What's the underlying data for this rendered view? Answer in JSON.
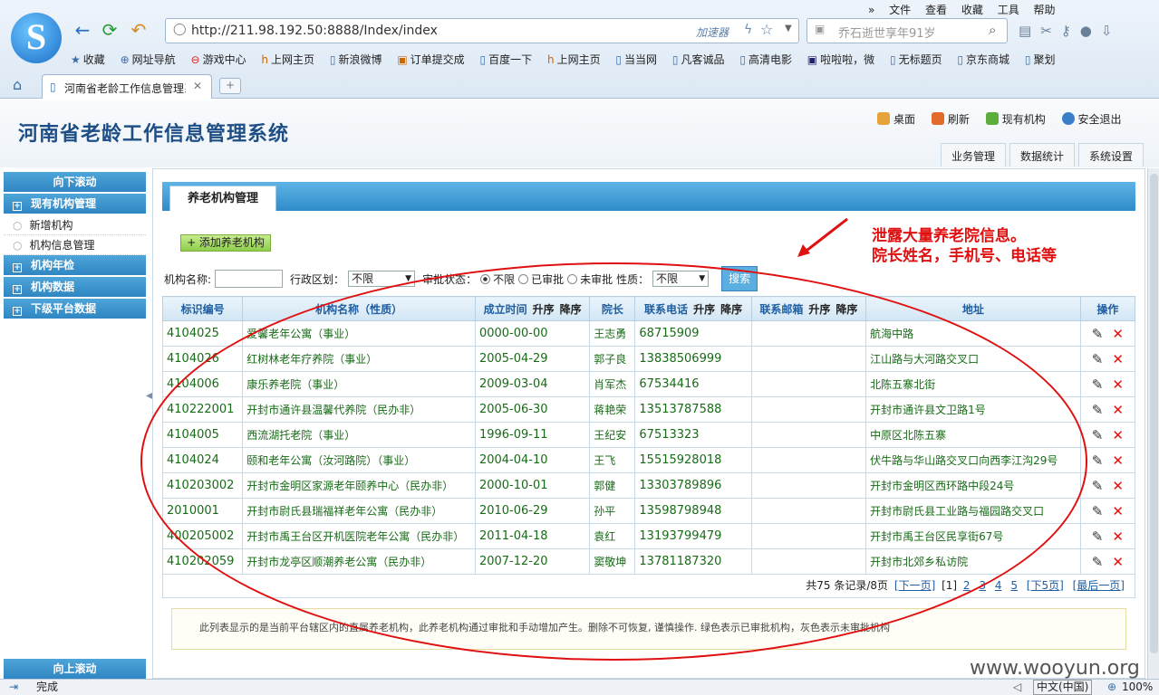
{
  "browser": {
    "menu": [
      "»",
      "文件",
      "查看",
      "收藏",
      "工具",
      "帮助"
    ],
    "url": "http://211.98.192.50:8888/Index/index",
    "accelerator": "加速器",
    "search_placeholder": "乔石逝世享年91岁",
    "bookmarks": [
      "收藏",
      "网址导航",
      "游戏中心",
      "上网主页",
      "新浪微博",
      "订单提交成",
      "百度一下",
      "上网主页",
      "当当网",
      "凡客诚品",
      "高清电影",
      "啦啦啦，微",
      "无标题页",
      "京东商城",
      "聚划"
    ],
    "tab_title": "河南省老龄工作信息管理系",
    "status_text": "完成",
    "ime": "中文(中国)",
    "zoom": "100%"
  },
  "app": {
    "title": "河南省老龄工作信息管理系统",
    "header_links": [
      "桌面",
      "刷新",
      "现有机构",
      "安全退出"
    ],
    "nav": [
      "业务管理",
      "数据统计",
      "系统设置"
    ]
  },
  "sidebar": {
    "scroll_down": "向下滚动",
    "scroll_up": "向上滚动",
    "groups": [
      {
        "label": "现有机构管理",
        "items": [
          "新增机构",
          "机构信息管理"
        ]
      },
      {
        "label": "机构年检",
        "items": []
      },
      {
        "label": "机构数据",
        "items": []
      },
      {
        "label": "下级平台数据",
        "items": []
      }
    ]
  },
  "main": {
    "tab": "养老机构管理",
    "add_button": "+ 添加养老机构",
    "filters": {
      "name_label": "机构名称:",
      "district_label": "行政区划：",
      "district_value": "不限",
      "status_label": "审批状态：",
      "status_options": [
        "不限",
        "已审批",
        "未审批"
      ],
      "type_label": "性质：",
      "type_value": "不限",
      "search_button": "搜索"
    },
    "columns": [
      "标识编号",
      "机构名称（性质）",
      "成立时间",
      "院长",
      "联系电话",
      "联系邮箱",
      "地址",
      "操作"
    ],
    "sort_asc": "升序",
    "sort_desc": "降序",
    "rows": [
      [
        "4104025",
        "爱馨老年公寓（事业）",
        "0000-00-00",
        "王志勇",
        "68715909",
        "",
        "航海中路"
      ],
      [
        "4104026",
        "红树林老年疗养院（事业）",
        "2005-04-29",
        "郭子良",
        "13838506999",
        "",
        "江山路与大河路交叉口"
      ],
      [
        "4104006",
        "康乐养老院（事业）",
        "2009-03-04",
        "肖军杰",
        "67534416",
        "",
        "北陈五寨北街"
      ],
      [
        "410222001",
        "开封市通许县温馨代养院（民办非）",
        "2005-06-30",
        "蒋艳荣",
        "13513787588",
        "",
        "开封市通许县文卫路1号"
      ],
      [
        "4104005",
        "西流湖托老院（事业）",
        "1996-09-11",
        "王纪安",
        "67513323",
        "",
        "中原区北陈五寨"
      ],
      [
        "4104024",
        "颐和老年公寓（汝河路院）（事业）",
        "2004-04-10",
        "王飞",
        "15515928018",
        "",
        "伏牛路与华山路交叉口向西李江沟29号"
      ],
      [
        "410203002",
        "开封市金明区家源老年颐养中心（民办非）",
        "2000-10-01",
        "郭健",
        "13303789896",
        "",
        "开封市金明区西环路中段24号"
      ],
      [
        "2010001",
        "开封市尉氏县瑞福祥老年公寓（民办非）",
        "2010-06-29",
        "孙平",
        "13598798948",
        "",
        "开封市尉氏县工业路与福园路交叉口"
      ],
      [
        "400205002",
        "开封市禹王台区开机医院老年公寓（民办非）",
        "2011-04-18",
        "袁红",
        "13193799479",
        "",
        "开封市禹王台区民享街67号"
      ],
      [
        "410202059",
        "开封市龙亭区顺潮养老公寓（民办非）",
        "2007-12-20",
        "窦敬坤",
        "13781187320",
        "",
        "开封市北郊乡私访院"
      ]
    ],
    "pager": {
      "summary": "共75 条记录/8页",
      "next": "[下一页]",
      "current": "[1]",
      "pages": [
        "2",
        "3",
        "4",
        "5"
      ],
      "next5": "[下5页]",
      "last": "[最后一页]"
    },
    "note": "此列表显示的是当前平台辖区内的直属养老机构，此养老机构通过审批和手动增加产生。删除不可恢复, 谨慎操作. 绿色表示已审批机构，灰色表示未审批机构"
  },
  "annotation": {
    "line1": "泄露大量养老院信息。",
    "line2": "院长姓名，手机号、电话等",
    "color": "#e01010"
  },
  "watermark": "www.wooyun.org"
}
